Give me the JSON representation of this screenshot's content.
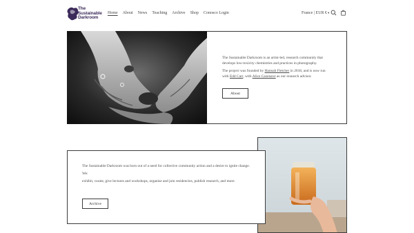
{
  "header": {
    "logo_text": [
      "The",
      "Sustainable",
      "Darkroom"
    ],
    "nav": [
      {
        "label": "Home"
      },
      {
        "label": "About"
      },
      {
        "label": "News"
      },
      {
        "label": "Teaching"
      },
      {
        "label": "Archive"
      },
      {
        "label": "Shop"
      },
      {
        "label": "Conosco Login"
      }
    ],
    "currency": "France | EUR €",
    "icons": [
      "search-icon",
      "cart-icon"
    ]
  },
  "intro": {
    "p1": "The Sustainable Darkroom is an artist-led, research community that develops low-toxicity chemistries and practices in photography.",
    "p2_a": "The project was founded by ",
    "p2_name1": "Hannah Fletcher",
    "p2_b": " in 2018, and is now run with ",
    "p2_name2": "Edd Carr",
    "p2_c": ", with ",
    "p2_name3": "Alice Cazenave",
    "p2_d": " as our research advisor.",
    "button": "About"
  },
  "mission": {
    "p1": "The Sustainable Darkroom was born out of a need for collective community action and a desire to ignite change.",
    "p2": "We:",
    "p3": "exhibit, curate, give lectures and workshops, organise and join residencies, publish research, and more.",
    "button": "Archive"
  },
  "colors": {
    "border": "#3a3a3a",
    "logo": "#3b2a5a",
    "text": "#4a4a4a"
  }
}
